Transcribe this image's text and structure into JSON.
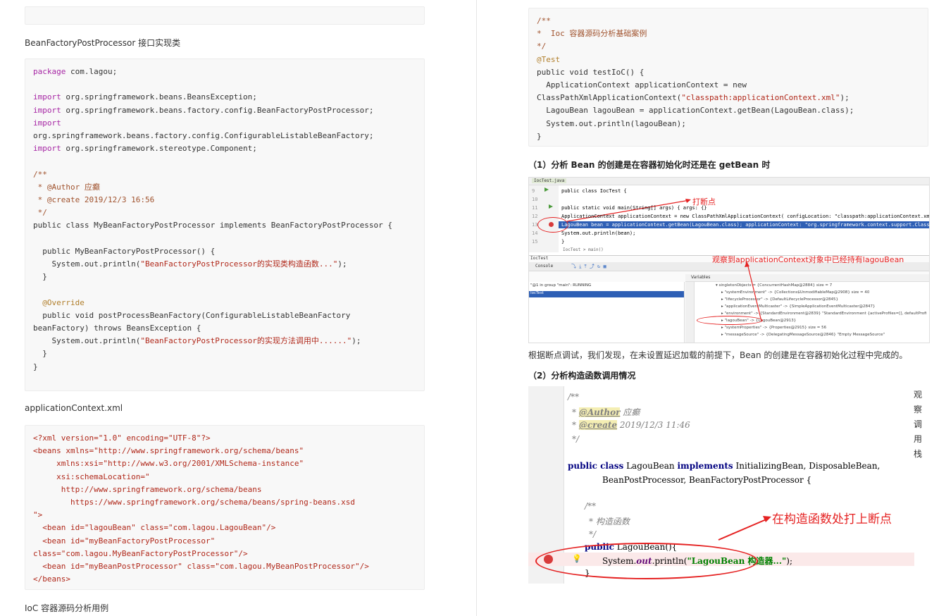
{
  "left": {
    "heading_postprocessor": "BeanFactoryPostProcessor 接口实现类",
    "heading_xml": "applicationContext.xml",
    "heading_ioc": "IoC 容器源码分析用例",
    "code_postprocessor": [
      "package com.lagou;",
      "",
      "import org.springframework.beans.BeansException;",
      "import org.springframework.beans.factory.config.BeanFactoryPostProcessor;",
      "import",
      "org.springframework.beans.factory.config.ConfigurableListableBeanFactory;",
      "import org.springframework.stereotype.Component;",
      "",
      "/**",
      " * @Author 应癫",
      " * @create 2019/12/3 16:56",
      " */",
      "public class MyBeanFactoryPostProcessor implements BeanFactoryPostProcessor {",
      "",
      "  public MyBeanFactoryPostProcessor() {",
      "    System.out.println(\"BeanFactoryPostProcessor的实现类构造函数...\");",
      "  }",
      "",
      "  @Override",
      "  public void postProcessBeanFactory(ConfigurableListableBeanFactory",
      "beanFactory) throws BeansException {",
      "    System.out.println(\"BeanFactoryPostProcessor的实现方法调用中......\");",
      "  }",
      "}"
    ],
    "code_xml": [
      "<?xml version=\"1.0\" encoding=\"UTF-8\"?>",
      "<beans xmlns=\"http://www.springframework.org/schema/beans\"",
      "     xmlns:xsi=\"http://www.w3.org/2001/XMLSchema-instance\"",
      "     xsi:schemaLocation=\"",
      "      http://www.springframework.org/schema/beans",
      "        https://www.springframework.org/schema/beans/spring-beans.xsd",
      "\">",
      "  <bean id=\"lagouBean\" class=\"com.lagou.LagouBean\"/>",
      "  <bean id=\"myBeanFactoryPostProcessor\"",
      "class=\"com.lagou.MyBeanFactoryPostProcessor\"/>",
      "  <bean id=\"myBeanPostProcessor\" class=\"com.lagou.MyBeanPostProcessor\"/>",
      "</beans>"
    ]
  },
  "right": {
    "code_test": [
      "/**",
      "*  Ioc 容器源码分析基础案例",
      "*/",
      "@Test",
      "public void testIoC() {",
      "  ApplicationContext applicationContext = new",
      "ClassPathXmlApplicationContext(\"classpath:applicationContext.xml\");",
      "  LagouBean lagouBean = applicationContext.getBean(LagouBean.class);",
      "  System.out.println(lagouBean);",
      "}"
    ],
    "heading1": "（1）分析 Bean 的创建是在容器初始化时还是在 getBean 时",
    "paragraph1": "根据断点调试，我们发现，在未设置延迟加载的前提下，Bean 的创建是在容器初始化过程中完成的。",
    "heading2": "（2）分析构造函数调用情况",
    "vertical_note": [
      "观",
      "察",
      "调",
      "用",
      "栈"
    ],
    "ide1": {
      "tab": "IocTest.java",
      "lines": [
        "public class IocTest {",
        "",
        "  public static void main(String[] args) {   args: {}",
        "    ApplicationContext applicationContext = new ClassPathXmlApplicationContext( configLocation: \"classpath:applicationContext.xml\");",
        "    LagouBean bean = applicationContext.getBean(LagouBean.class);   applicationContext: \"org.springframework.context.support.ClassPathXml",
        "    System.out.println(bean);",
        "  }"
      ],
      "line_numbers": [
        "9",
        "10",
        "11",
        "12",
        "13",
        "14",
        "15"
      ],
      "breadcrumb": "IocTest  >  main()",
      "annotation_breakpoint": "打断点",
      "annotation_observe": "观察到applicationContext对象中已经持有lagouBean",
      "debug_tab": "IocTest",
      "console_label": "Console",
      "frame": "\"@1 in group \"main\": RUNNING",
      "frame_selected": "IocTest",
      "vars_label": "Variables",
      "vars": [
        "▾ singletonObjects = {ConcurrentHashMap@2884}  size = 7",
        "▸ \"systemEnvironment\" -> {Collections$UnmodifiableMap@2908}  size = 40",
        "▸ \"lifecycleProcessor\" -> {DefaultLifecycleProcessor@2845}",
        "▸ \"applicationEventMulticaster\" -> {SimpleApplicationEventMulticaster@2847}",
        "▸ \"environment\" -> {StandardEnvironment@2839} \"StandardEnvironment {activeProfiles=[], defaultProfi",
        "▸ \"lagouBean\" -> {LagouBean@2913}",
        "▸ \"systemProperties\" -> {Properties@2915}  size = 56",
        "▸ \"messageSource\" -> {DelegatingMessageSource@2846} \"Empty MessageSource\""
      ]
    },
    "ide2": {
      "annotation": "在构造函数处打上断点"
    }
  },
  "colors": {
    "annotation_red": "#e52222",
    "highlight_blue": "#2e5fb5"
  }
}
